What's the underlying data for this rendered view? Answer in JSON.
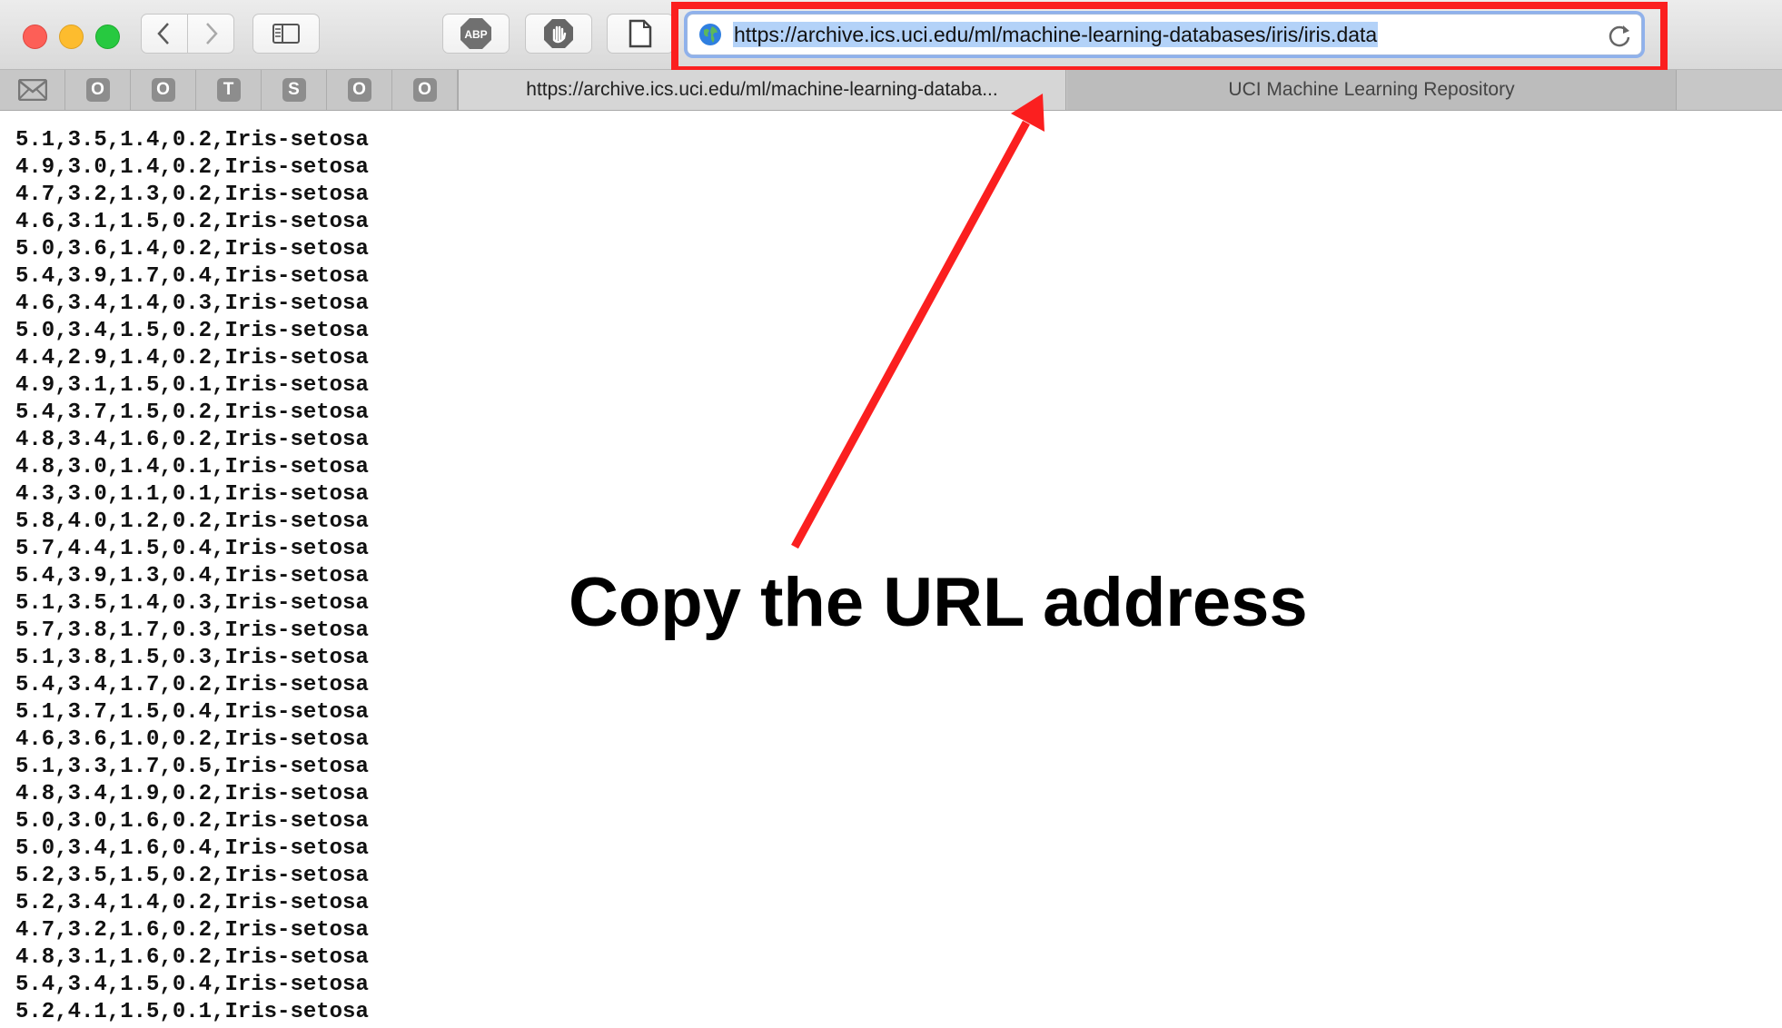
{
  "toolbar": {
    "url": "https://archive.ics.uci.edu/ml/machine-learning-databases/iris/iris.data",
    "abp_label": "ABP"
  },
  "bookmarks": [
    "O",
    "O",
    "T",
    "S",
    "O",
    "O"
  ],
  "tabs": [
    {
      "label": "https://archive.ics.uci.edu/ml/machine-learning-databa..."
    },
    {
      "label": "UCI Machine Learning Repository"
    }
  ],
  "lines": [
    "5.1,3.5,1.4,0.2,Iris-setosa",
    "4.9,3.0,1.4,0.2,Iris-setosa",
    "4.7,3.2,1.3,0.2,Iris-setosa",
    "4.6,3.1,1.5,0.2,Iris-setosa",
    "5.0,3.6,1.4,0.2,Iris-setosa",
    "5.4,3.9,1.7,0.4,Iris-setosa",
    "4.6,3.4,1.4,0.3,Iris-setosa",
    "5.0,3.4,1.5,0.2,Iris-setosa",
    "4.4,2.9,1.4,0.2,Iris-setosa",
    "4.9,3.1,1.5,0.1,Iris-setosa",
    "5.4,3.7,1.5,0.2,Iris-setosa",
    "4.8,3.4,1.6,0.2,Iris-setosa",
    "4.8,3.0,1.4,0.1,Iris-setosa",
    "4.3,3.0,1.1,0.1,Iris-setosa",
    "5.8,4.0,1.2,0.2,Iris-setosa",
    "5.7,4.4,1.5,0.4,Iris-setosa",
    "5.4,3.9,1.3,0.4,Iris-setosa",
    "5.1,3.5,1.4,0.3,Iris-setosa",
    "5.7,3.8,1.7,0.3,Iris-setosa",
    "5.1,3.8,1.5,0.3,Iris-setosa",
    "5.4,3.4,1.7,0.2,Iris-setosa",
    "5.1,3.7,1.5,0.4,Iris-setosa",
    "4.6,3.6,1.0,0.2,Iris-setosa",
    "5.1,3.3,1.7,0.5,Iris-setosa",
    "4.8,3.4,1.9,0.2,Iris-setosa",
    "5.0,3.0,1.6,0.2,Iris-setosa",
    "5.0,3.4,1.6,0.4,Iris-setosa",
    "5.2,3.5,1.5,0.2,Iris-setosa",
    "5.2,3.4,1.4,0.2,Iris-setosa",
    "4.7,3.2,1.6,0.2,Iris-setosa",
    "4.8,3.1,1.6,0.2,Iris-setosa",
    "5.4,3.4,1.5,0.4,Iris-setosa",
    "5.2,4.1,1.5,0.1,Iris-setosa"
  ],
  "annotation": {
    "text": "Copy the URL address",
    "color": "#fb1f1f"
  }
}
